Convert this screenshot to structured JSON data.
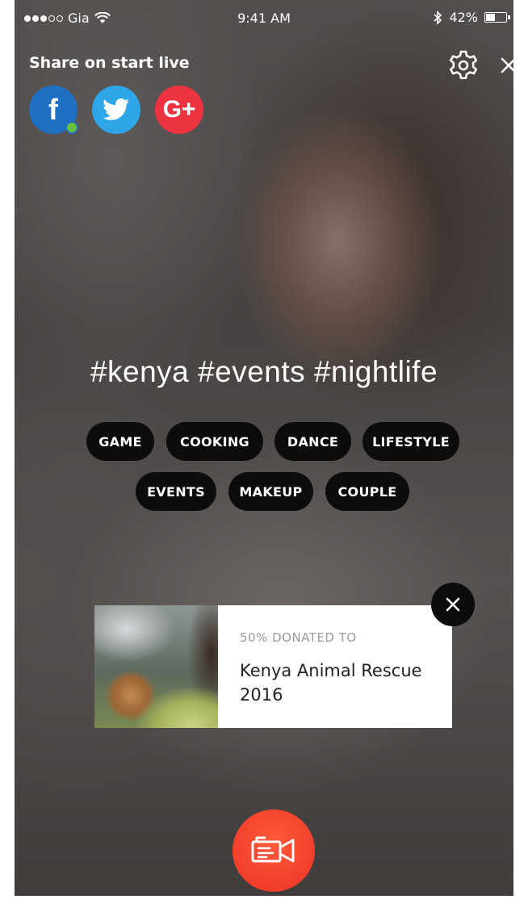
{
  "status_bar": {
    "carrier": "Gia",
    "time": "9:41 AM",
    "battery_percent": "42%",
    "battery_level": 0.42,
    "signal_bars_filled": 3,
    "signal_bars_total": 5
  },
  "share": {
    "label": "Share on start live",
    "networks": [
      {
        "name": "facebook",
        "glyph": "f",
        "color": "#1f6fc3",
        "online": true
      },
      {
        "name": "twitter",
        "glyph": "twitter-bird",
        "color": "#2ea5e6"
      },
      {
        "name": "google-plus",
        "glyph": "G+",
        "color": "#ee3340"
      }
    ]
  },
  "top_actions": {
    "settings_icon": "gear-icon",
    "close_icon": "close-icon"
  },
  "hashtags": "#kenya #events #nightlife",
  "categories": [
    "GAME",
    "COOKING",
    "DANCE",
    "LIFESTYLE",
    "EVENTS",
    "MAKEUP",
    "COUPLE"
  ],
  "donation": {
    "label": "50% DONATED TO",
    "title": "Kenya Animal Rescue 2016",
    "close_icon": "close-icon"
  },
  "record_button": {
    "icon": "video-camera-icon",
    "color": "#f23e2a"
  }
}
